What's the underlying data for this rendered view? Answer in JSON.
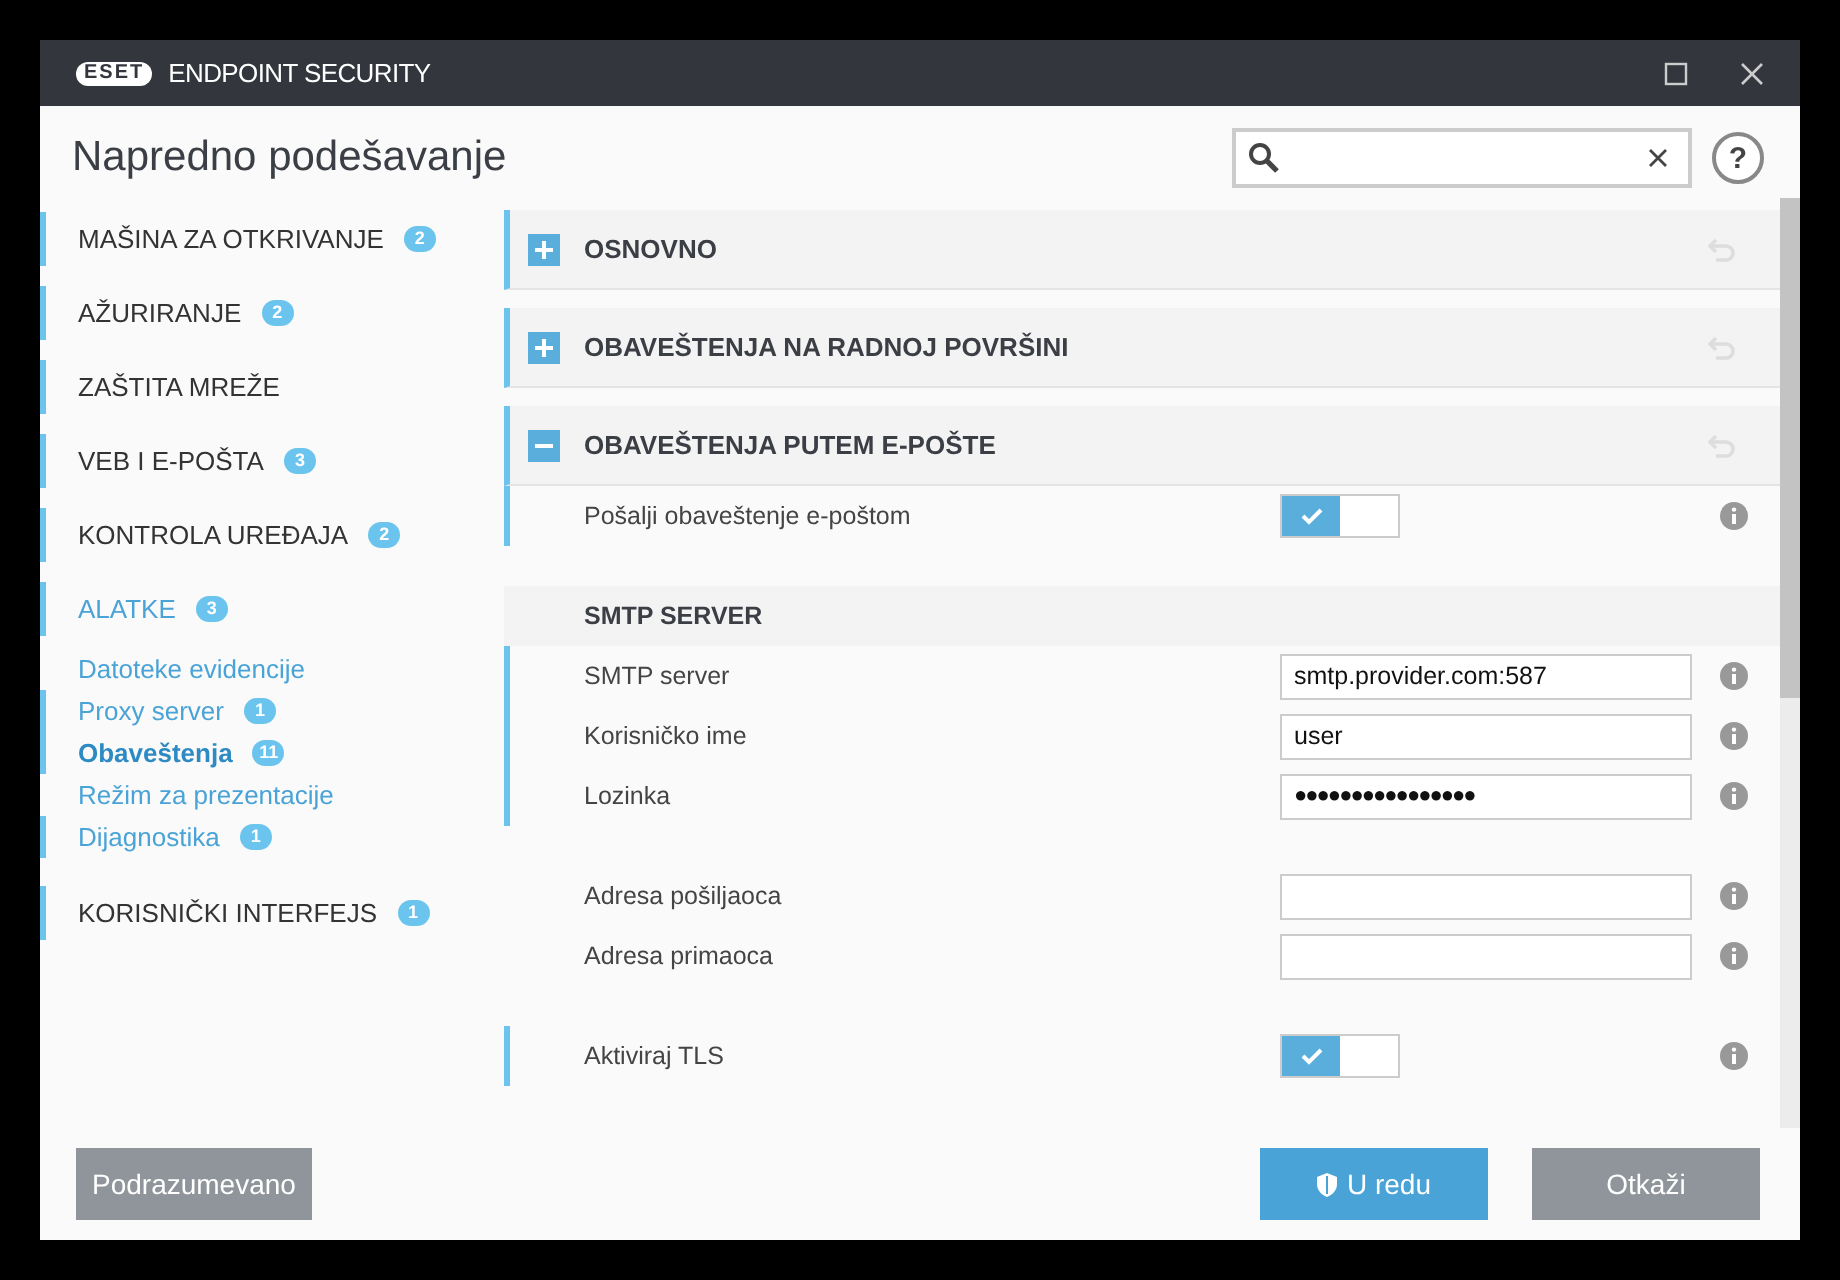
{
  "window": {
    "brand": "ESET",
    "product": "ENDPOINT SECURITY"
  },
  "header": {
    "title": "Napredno podešavanje",
    "help": "?"
  },
  "sidebar": {
    "items": [
      {
        "label": "MAŠINA ZA OTKRIVANJE",
        "badge": "2",
        "modified": true,
        "expanded": false
      },
      {
        "label": "AŽURIRANJE",
        "badge": "2",
        "modified": true,
        "expanded": false
      },
      {
        "label": "ZAŠTITA MREŽE",
        "modified": true,
        "expanded": false
      },
      {
        "label": "VEB I E-POŠTA",
        "badge": "3",
        "modified": true,
        "expanded": false
      },
      {
        "label": "KONTROLA UREĐAJA",
        "badge": "2",
        "modified": true,
        "expanded": false
      },
      {
        "label": "ALATKE",
        "badge": "3",
        "modified": true,
        "expanded": true,
        "children": [
          {
            "label": "Datoteke evidencije",
            "modified": false,
            "selected": false
          },
          {
            "label": "Proxy server",
            "badge": "1",
            "modified": true,
            "selected": false
          },
          {
            "label": "Obaveštenja",
            "badge": "11",
            "modified": true,
            "selected": true
          },
          {
            "label": "Režim za prezentacije",
            "modified": false,
            "selected": false
          },
          {
            "label": "Dijagnostika",
            "badge": "1",
            "modified": true,
            "selected": false
          }
        ]
      },
      {
        "label": "KORISNIČKI INTERFEJS",
        "badge": "1",
        "modified": true,
        "expanded": false
      }
    ]
  },
  "sections": [
    {
      "title": "OSNOVNO",
      "expanded": false,
      "modified": true
    },
    {
      "title": "OBAVEŠTENJA NA RADNOJ POVRŠINI",
      "expanded": false,
      "modified": true
    },
    {
      "title": "OBAVEŠTENJA PUTEM E-POŠTE",
      "expanded": true,
      "modified": true,
      "rows": [
        {
          "kind": "toggle",
          "label": "Pošalji obaveštenje e-poštom",
          "on": true,
          "modified": true
        },
        {
          "kind": "spacer"
        },
        {
          "kind": "heading",
          "label": "SMTP SERVER"
        },
        {
          "kind": "text",
          "label": "SMTP server",
          "value": "smtp.provider.com:587",
          "modified": true
        },
        {
          "kind": "text",
          "label": "Korisničko ime",
          "value": "user",
          "modified": true
        },
        {
          "kind": "password",
          "label": "Lozinka",
          "value": "●●●●●●●●●●●●●●●●",
          "modified": true
        },
        {
          "kind": "spacer"
        },
        {
          "kind": "text",
          "label": "Adresa pošiljaoca",
          "modified": false
        },
        {
          "kind": "text",
          "label": "Adresa primaoca",
          "modified": false
        },
        {
          "kind": "spacer"
        },
        {
          "kind": "toggle",
          "label": "Aktiviraj TLS",
          "on": true,
          "modified": true
        }
      ]
    }
  ],
  "footer": {
    "buttons": [
      {
        "label": "Podrazumevano",
        "kind": "default"
      },
      {
        "label": "U redu",
        "kind": "primary"
      },
      {
        "label": "Otkaži",
        "kind": "default"
      }
    ]
  }
}
